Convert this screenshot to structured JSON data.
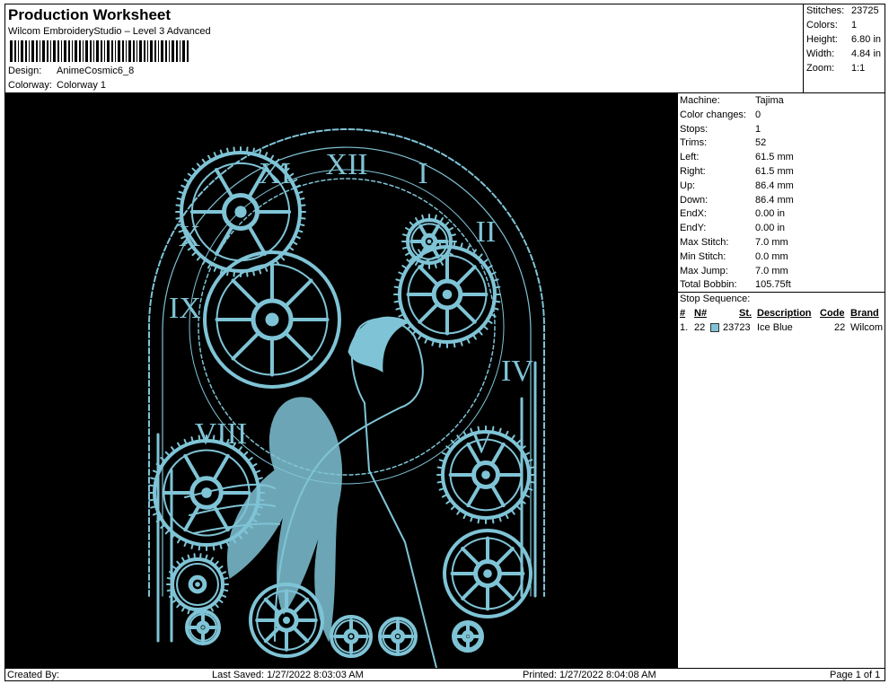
{
  "header": {
    "title": "Production Worksheet",
    "subtitle": "Wilcom EmbroideryStudio – Level 3 Advanced",
    "design_label": "Design:",
    "design_value": "AnimeCosmic6_8",
    "colorway_label": "Colorway:",
    "colorway_value": "Colorway 1"
  },
  "summary": [
    {
      "label": "Stitches:",
      "value": "23725"
    },
    {
      "label": "Colors:",
      "value": "1"
    },
    {
      "label": "Height:",
      "value": "6.80 in"
    },
    {
      "label": "Width:",
      "value": "4.84 in"
    },
    {
      "label": "Zoom:",
      "value": "1:1"
    }
  ],
  "specs": [
    {
      "label": "Machine:",
      "value": "Tajima"
    },
    {
      "label": "Color changes:",
      "value": "0"
    },
    {
      "label": "Stops:",
      "value": "1"
    },
    {
      "label": "Trims:",
      "value": "52"
    },
    {
      "label": "Left:",
      "value": "61.5 mm"
    },
    {
      "label": "Right:",
      "value": "61.5 mm"
    },
    {
      "label": "Up:",
      "value": "86.4 mm"
    },
    {
      "label": "Down:",
      "value": "86.4 mm"
    },
    {
      "label": "EndX:",
      "value": "0.00 in"
    },
    {
      "label": "EndY:",
      "value": "0.00 in"
    },
    {
      "label": "Max Stitch:",
      "value": "7.0 mm"
    },
    {
      "label": "Min Stitch:",
      "value": "0.0 mm"
    },
    {
      "label": "Max Jump:",
      "value": "7.0 mm"
    },
    {
      "label": "Total Bobbin:",
      "value": "105.75ft"
    }
  ],
  "stop_sequence": {
    "title": "Stop Sequence:",
    "headers": {
      "num": "#",
      "n": "N#",
      "st": "St.",
      "desc": "Description",
      "code": "Code",
      "brand": "Brand"
    },
    "rows": [
      {
        "num": "1.",
        "n": "22",
        "st": "23723",
        "desc": "Ice Blue",
        "code": "22",
        "brand": "Wilcom",
        "color": "#7fc4d6"
      }
    ]
  },
  "design_preview": {
    "thread_color": "#7fc4d6",
    "background": "#000000",
    "numerals": [
      "XII",
      "I",
      "II",
      "IV",
      "V",
      "VIII",
      "IX",
      "X",
      "XI"
    ]
  },
  "footer": {
    "created_by": "Created By:",
    "last_saved": "Last Saved: 1/27/2022 8:03:03 AM",
    "printed": "Printed: 1/27/2022 8:04:08 AM",
    "page": "Page 1 of 1"
  }
}
